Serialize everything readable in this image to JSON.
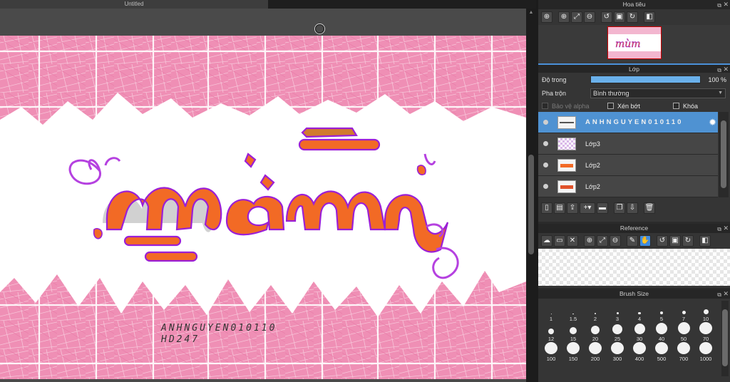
{
  "document": {
    "tab_title": "Untitled"
  },
  "canvas": {
    "signature_line1": "ANHNGUYEN010110",
    "signature_line2": "HD247",
    "art_colors": {
      "pink_bg": "#ef8fb5",
      "orange": "#f26a25",
      "purple_outline": "#9b1fd6"
    }
  },
  "navigator": {
    "title": "Hoa tiêu",
    "tools": [
      "zoom-fit-icon",
      "zoom-in-icon",
      "fit-screen-icon",
      "zoom-out-icon",
      "rotate-left-icon",
      "actual-size-icon",
      "rotate-right-icon",
      "flip-icon"
    ]
  },
  "layers_panel": {
    "title": "Lớp",
    "opacity_label": "Độ trong",
    "opacity_value": "100 %",
    "opacity_fraction": 1.0,
    "blend_label": "Pha trộn",
    "blend_value": "Bình thường",
    "protect_alpha_label": "Bảo vệ alpha",
    "clipping_label": "Xén bớt",
    "lock_label": "Khóa",
    "layers": [
      {
        "name": "ANHNGUYEN010110",
        "selected": true
      },
      {
        "name": "Lớp3",
        "selected": false
      },
      {
        "name": "Lớp2",
        "selected": false
      },
      {
        "name": "Lớp2",
        "selected": false
      }
    ],
    "actions": [
      "new-layer-icon",
      "new-halftone-layer-icon",
      "import-icon",
      "add-layer-dropdown-icon",
      "folder-icon",
      "duplicate-icon",
      "merge-icon",
      "delete-icon"
    ]
  },
  "reference": {
    "title": "Reference",
    "tools": [
      "cloud-open-icon",
      "open-folder-icon",
      "close-icon",
      "zoom-in-icon",
      "fit-screen-icon",
      "zoom-out-icon",
      "eyedropper-icon",
      "hand-icon",
      "rotate-left-icon",
      "actual-size-icon",
      "rotate-right-icon",
      "flip-icon"
    ]
  },
  "brush_size": {
    "title": "Brush Size",
    "sizes": [
      "1",
      "1.5",
      "2",
      "3",
      "4",
      "5",
      "7",
      "10",
      "12",
      "15",
      "20",
      "25",
      "30",
      "40",
      "50",
      "70",
      "100",
      "150",
      "200",
      "300",
      "400",
      "500",
      "700",
      "1000"
    ]
  }
}
